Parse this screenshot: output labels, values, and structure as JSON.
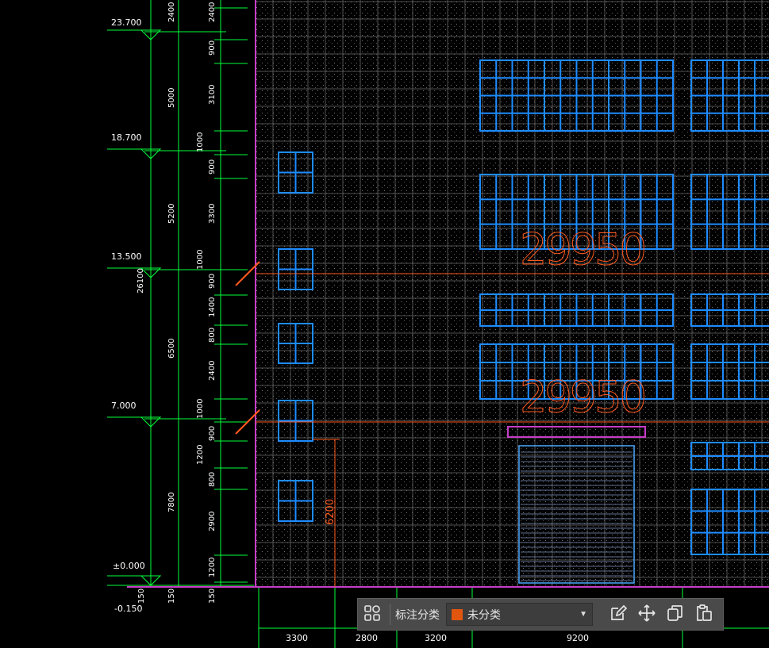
{
  "drawing": {
    "elevation_labels": [
      "23.700",
      "18.700",
      "13.500",
      "7.000",
      "±0.000",
      "-0.150"
    ],
    "total_height": "26100",
    "storey_dims": [
      "2400",
      "5000",
      "5200",
      "6500",
      "7800",
      "150"
    ],
    "detail_dims": [
      "2400",
      "900",
      "3100",
      "1000",
      "900",
      "3300",
      "1000",
      "900",
      "1400",
      "800",
      "2400",
      "1000",
      "900",
      "1200",
      "800",
      "2900",
      "1200",
      "150"
    ],
    "bottom_dims": [
      "3300",
      "2800",
      "3200",
      "9200"
    ],
    "big_labels": [
      "29950",
      "29950"
    ],
    "opening_dim": "6200",
    "colors": {
      "grid": "#6b6b6b",
      "dim": "#00ff3c",
      "window": "#1e8cff",
      "accent": "#ff5a1e",
      "border": "#c83cc8"
    }
  },
  "toolbar": {
    "label": "标注分类",
    "category_value": "未分类",
    "category_color": "#e0560f",
    "icons": [
      "grid-select-icon",
      "edit-icon",
      "move-icon",
      "copy-icon",
      "paste-icon"
    ]
  }
}
